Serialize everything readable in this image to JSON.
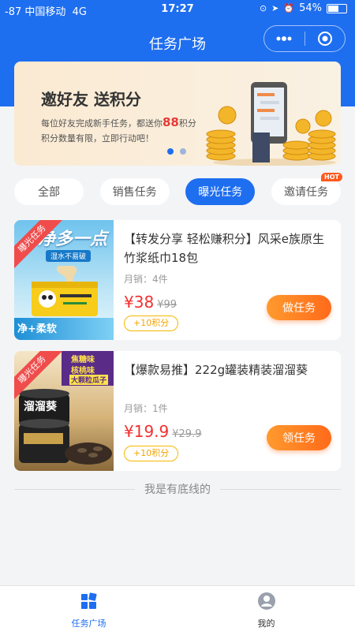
{
  "status": {
    "signal": "-87 中国移动",
    "network": "4G",
    "time": "17:27",
    "battery": "54%"
  },
  "nav": {
    "title": "任务广场",
    "more_icon": "more-dots-icon",
    "close_icon": "target-circle-icon"
  },
  "banner": {
    "title": "邀好友  送积分",
    "line1_pre": "每位好友完成新手任务，都送你",
    "line1_num": "88",
    "line1_post": "积分",
    "line2": "积分数量有限，立即行动吧！"
  },
  "tabs": [
    {
      "label": "全部"
    },
    {
      "label": "销售任务"
    },
    {
      "label": "曝光任务"
    },
    {
      "label": "邀请任务",
      "badge": "HOT"
    }
  ],
  "products": [
    {
      "ribbon": "曝光任务",
      "img_text1": "净多一点",
      "img_text2": "湿水不易破",
      "img_text3": "净+柔软",
      "title": "【转发分享 轻松赚积分】风采e族原生竹浆纸巾18包",
      "sales": "月销：4件",
      "price": "¥38",
      "old_price": "¥99",
      "points": "+10积分",
      "button": "做任务"
    },
    {
      "ribbon": "曝光任务",
      "img_text1": "焦糖味",
      "img_text2": "核桃味",
      "img_text3": "大颗粒瓜子",
      "img_text4": "溜溜葵",
      "title": "【爆款易推】222g罐装精装溜溜葵",
      "sales": "月销：1件",
      "price": "¥19.9",
      "old_price": "¥29.9",
      "points": "+10积分",
      "button": "领任务"
    }
  ],
  "footer_note": "我是有底线的",
  "tabbar": [
    {
      "label": "任务广场",
      "icon": "grid-squares-icon"
    },
    {
      "label": "我的",
      "icon": "user-avatar-icon"
    }
  ],
  "colors": {
    "primary": "#1e6ef0",
    "price": "#f23030",
    "button": "#ff7a20"
  }
}
